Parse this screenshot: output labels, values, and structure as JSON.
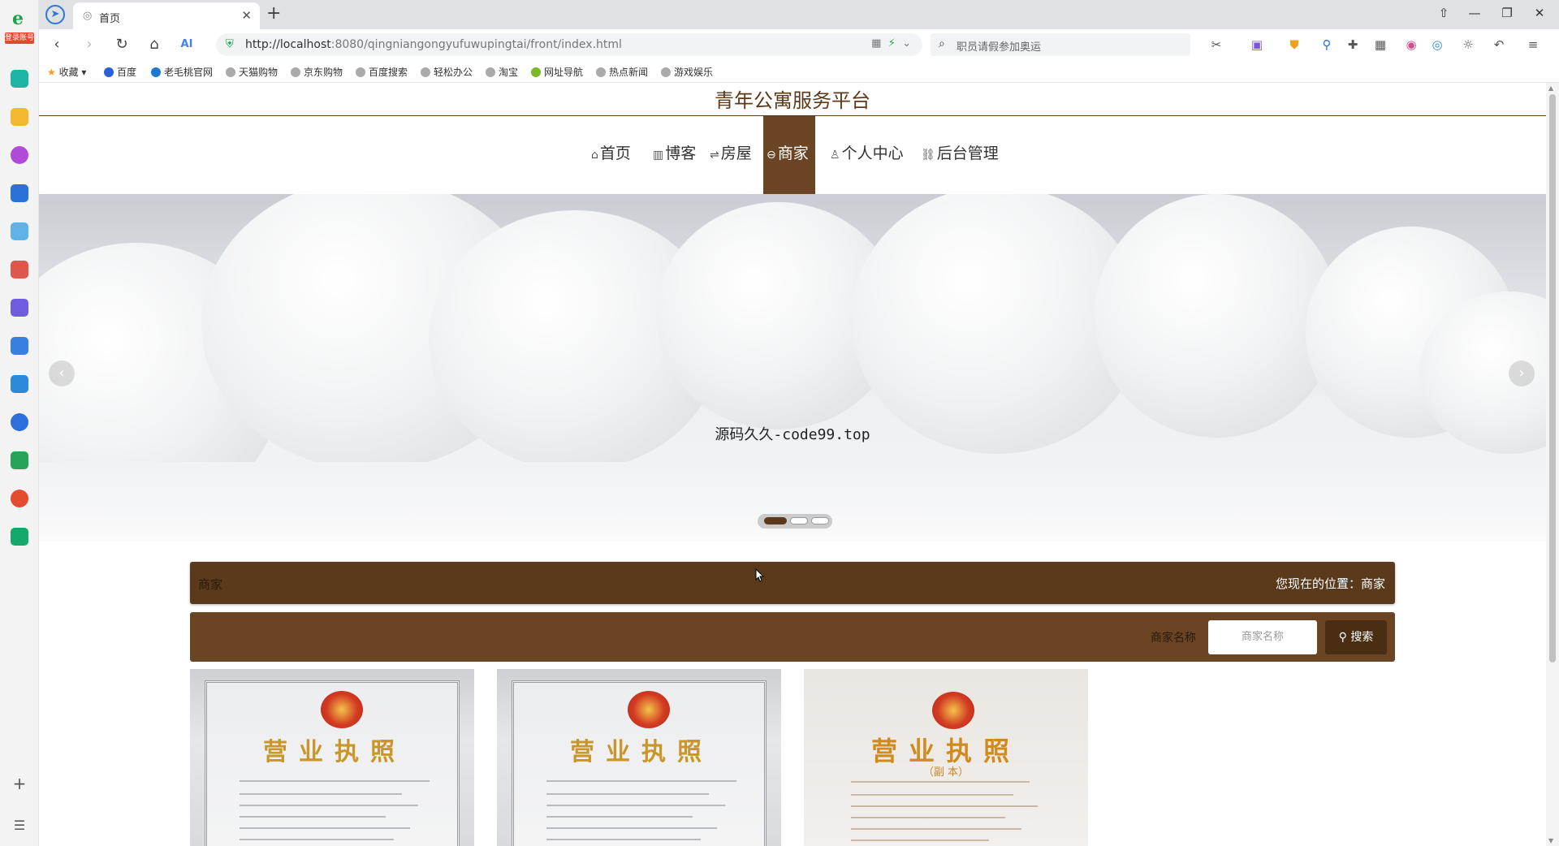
{
  "browser": {
    "sidebar_logo_tag": "登录账号",
    "tab_title": "首页",
    "url_host": "http://localhost",
    "url_rest": ":8080/qingniangongyufuwupingtai/front/index.html",
    "search_placeholder": "职员请假参加奥运",
    "bookmarks": [
      "收藏",
      "百度",
      "老毛桃官网",
      "天猫购物",
      "京东购物",
      "百度搜索",
      "轻松办公",
      "淘宝",
      "网址导航",
      "热点新闻",
      "游戏娱乐"
    ]
  },
  "site": {
    "title": "青年公寓服务平台",
    "nav": [
      {
        "label": "首页",
        "icon": "home-icon"
      },
      {
        "label": "博客",
        "icon": "gift-icon"
      },
      {
        "label": "房屋",
        "icon": "filter-icon"
      },
      {
        "label": "商家",
        "icon": "shop-icon",
        "active": true
      },
      {
        "label": "个人中心",
        "icon": "user-icon"
      },
      {
        "label": "后台管理",
        "icon": "link-icon"
      }
    ]
  },
  "banner": {
    "caption": "源码久久-code99.top",
    "slide_count": 3,
    "active_slide": 1
  },
  "merchant": {
    "section_label": "商家",
    "location_label": "您现在的位置：商家",
    "search_label": "商家名称",
    "search_placeholder": "商家名称",
    "search_button": "搜索",
    "cards": [
      {
        "heading": "营业执照"
      },
      {
        "heading": "营业执照"
      },
      {
        "heading": "营业执照",
        "sub": "（副 本）"
      }
    ]
  },
  "colors": {
    "brand_brown": "#5a3a1a",
    "nav_active": "#6b4423",
    "search_bar": "#6b4423"
  }
}
